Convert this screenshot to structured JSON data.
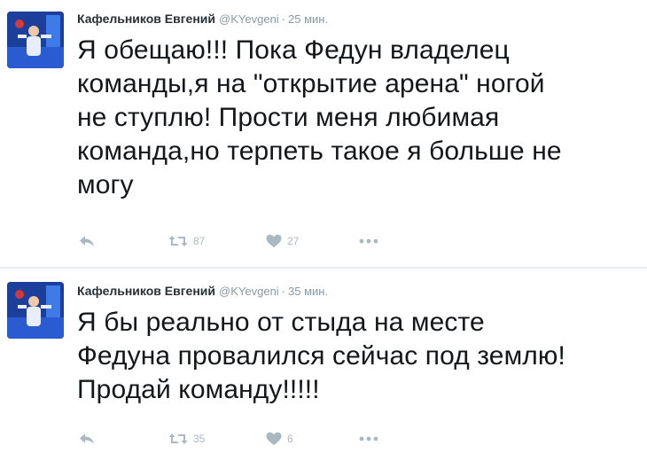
{
  "tweets": [
    {
      "author_name": "Кафельников Евгений",
      "handle": "@KYevgeni",
      "separator": "·",
      "time": "25 мин.",
      "text_lines": [
        "Я обещаю!!! Пока Федун владелец",
        "команды,я на \"открытие арена\" ногой",
        "не ступлю! Прости меня любимая",
        "команда,но терпеть такое я больше не",
        "могу"
      ],
      "retweet_count": "87",
      "like_count": "27"
    },
    {
      "author_name": "Кафельников Евгений",
      "handle": "@KYevgeni",
      "separator": "·",
      "time": "35 мин.",
      "text_lines": [
        "Я бы реально от стыда на месте",
        "Федуна провалился сейчас под землю!",
        "Продай команду!!!!!"
      ],
      "retweet_count": "35",
      "like_count": "6"
    }
  ],
  "icons": {
    "reply": "reply-icon",
    "retweet": "retweet-icon",
    "like": "heart-icon",
    "more": "more-dots-icon"
  },
  "colors": {
    "text": "#14171a",
    "muted": "#8899a6",
    "action_gray": "#aab8c2",
    "divider": "#e6ecf0",
    "avatar_bg": "#1b3f9a"
  }
}
